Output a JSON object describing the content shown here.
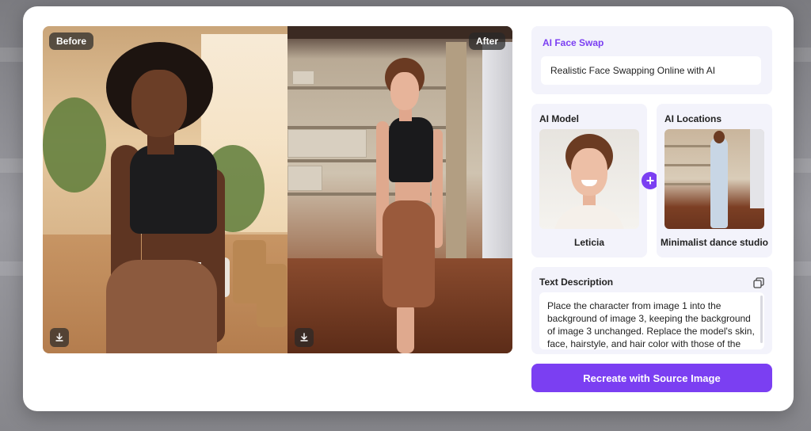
{
  "compare": {
    "before_label": "Before",
    "after_label": "After",
    "download_icon": "download-icon"
  },
  "face_swap": {
    "title": "AI Face Swap",
    "value": "Realistic Face Swapping Online with AI"
  },
  "model": {
    "title": "AI Model",
    "name": "Leticia"
  },
  "location": {
    "title": "AI Locations",
    "name": "Minimalist dance studio"
  },
  "plus_icon": "plus-icon",
  "description": {
    "title": "Text Description",
    "copy_icon": "copy-icon",
    "text": "Place the character from image 1 into the background of image 3, keeping the background of image 3 unchanged. Replace the model's skin, face, hairstyle, and hair color with those of the"
  },
  "cta_label": "Recreate with Source Image",
  "colors": {
    "accent": "#7b3ff2",
    "card_bg": "#f3f3fb"
  }
}
